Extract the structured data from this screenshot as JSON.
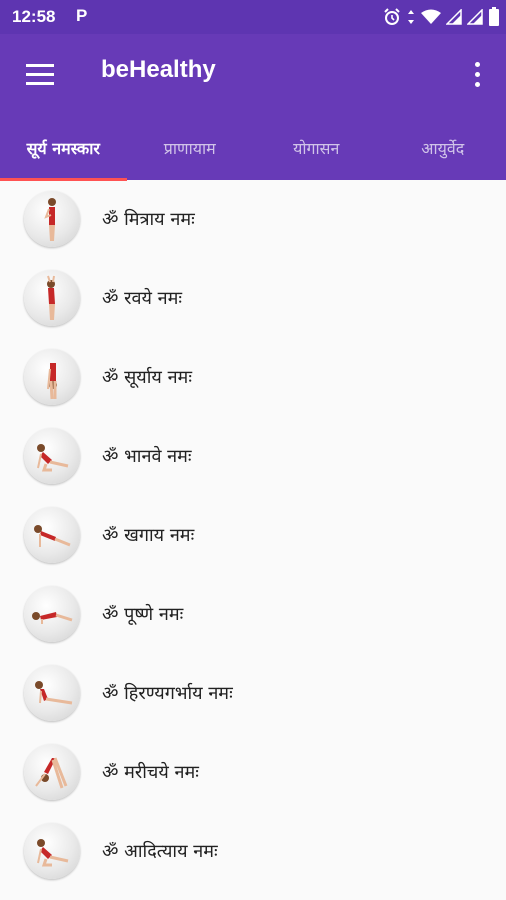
{
  "status_bar": {
    "time": "12:58",
    "notification_icon": "P",
    "icons": [
      "alarm-icon",
      "data-arrows-icon",
      "wifi-icon",
      "signal-icon",
      "signal-icon",
      "battery-icon"
    ]
  },
  "app_bar": {
    "title": "beHealthy",
    "menu_icon": "hamburger-icon",
    "more_icon": "more-vert-icon",
    "color": "#673ab7"
  },
  "tabs": [
    {
      "label": "सूर्य नमस्कार",
      "active": true
    },
    {
      "label": "प्राणायाम",
      "active": false
    },
    {
      "label": "योगासन",
      "active": false
    },
    {
      "label": "आयुर्वेद",
      "active": false
    }
  ],
  "tab_indicator_color": "#ff5252",
  "poses": [
    {
      "label": "ॐ मित्राय नमः",
      "pose": "standing-pray"
    },
    {
      "label": "ॐ रवये नमः",
      "pose": "arms-raised"
    },
    {
      "label": "ॐ सूर्याय नमः",
      "pose": "forward-bend"
    },
    {
      "label": "ॐ भानवे नमः",
      "pose": "lunge"
    },
    {
      "label": "ॐ खगाय नमः",
      "pose": "plank"
    },
    {
      "label": "ॐ पूष्णे नमः",
      "pose": "eight-limb"
    },
    {
      "label": "ॐ हिरण्यगर्भाय नमः",
      "pose": "cobra"
    },
    {
      "label": "ॐ मरीचये नमः",
      "pose": "downward-dog"
    },
    {
      "label": "ॐ आदित्याय नमः",
      "pose": "lunge"
    }
  ]
}
